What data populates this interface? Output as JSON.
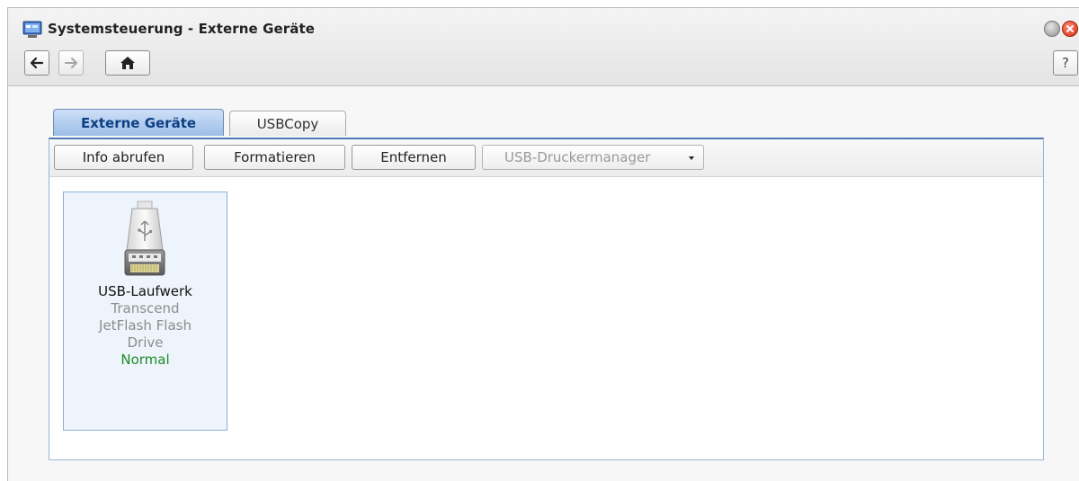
{
  "window": {
    "title": "Systemsteuerung - Externe Geräte",
    "help_label": "?"
  },
  "tabs": [
    {
      "label": "Externe Geräte",
      "active": true
    },
    {
      "label": "USBCopy",
      "active": false
    }
  ],
  "toolbar": {
    "info_label": "Info abrufen",
    "format_label": "Formatieren",
    "remove_label": "Entfernen",
    "printer_manager_label": "USB-Druckermanager"
  },
  "devices": [
    {
      "name": "USB-Laufwerk",
      "model_line1": "Transcend",
      "model_line2": "JetFlash Flash",
      "model_line3": "Drive",
      "status": "Normal",
      "status_color": "#1e8a26"
    }
  ],
  "colors": {
    "accent": "#4f79b4",
    "active_tab_text": "#0d3f84"
  },
  "icons": [
    "control-panel-icon",
    "minimize-icon",
    "close-icon",
    "back-arrow-icon",
    "forward-arrow-icon",
    "home-icon",
    "help-icon",
    "usb-drive-icon",
    "dropdown-caret-icon"
  ]
}
